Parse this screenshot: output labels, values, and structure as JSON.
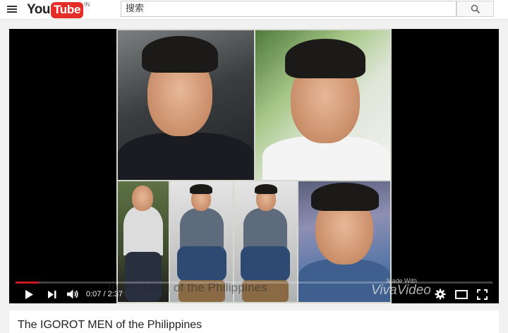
{
  "masthead": {
    "menu_icon": "hamburger-menu-icon",
    "logo": {
      "you": "You",
      "tube": "Tube",
      "region": "IN"
    },
    "search": {
      "placeholder": "搜索",
      "button_icon": "search-icon"
    }
  },
  "player": {
    "overlay_text": "Igorot MEN of the Philippines",
    "watermark": {
      "small": "Made With",
      "big": "VivaVideo"
    },
    "progress_fraction": 0.049,
    "colors": {
      "progress": "#cc181e",
      "brand": "#e52d27"
    },
    "controls": {
      "play_icon": "play-icon",
      "next_icon": "next-icon",
      "volume_icon": "volume-icon",
      "time": "0:07 / 2:37",
      "settings_icon": "gear-icon",
      "theater_icon": "theater-mode-icon",
      "fullscreen_icon": "fullscreen-icon"
    }
  },
  "video": {
    "title": "The IGOROT MEN of the Philippines"
  }
}
